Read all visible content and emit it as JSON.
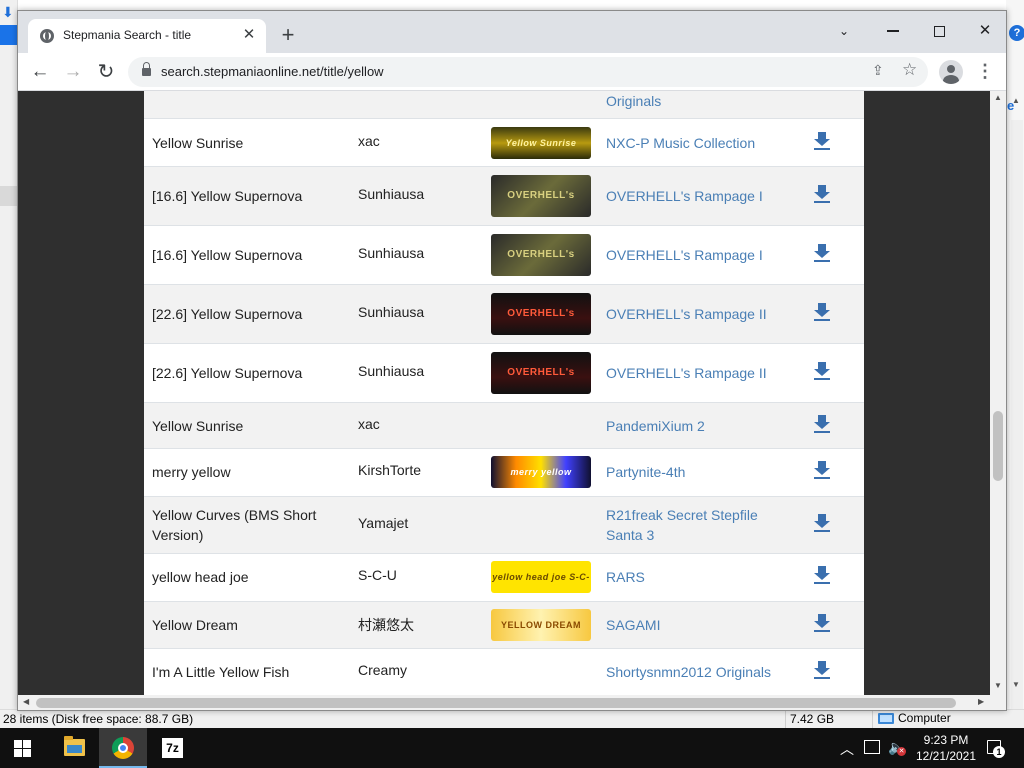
{
  "browser": {
    "tab_title": "Stepmania Search - title",
    "url": "search.stepmaniaonline.net/title/yellow",
    "tab_close": "✕",
    "new_tab": "+"
  },
  "partial_row": {
    "pack": "Originals"
  },
  "rows": [
    {
      "title": "Yellow Sunrise",
      "artist": "xac",
      "banner_text": "Yellow Sunrise",
      "pack": "NXC-P Music Collection"
    },
    {
      "title": "[16.6] Yellow Supernova",
      "artist": "Sunhiausa",
      "banner_text": "OVERHELL's RAMPAGE",
      "pack": "OVERHELL's Rampage I"
    },
    {
      "title": "[16.6] Yellow Supernova",
      "artist": "Sunhiausa",
      "banner_text": "OVERHELL's RAMPAGE",
      "pack": "OVERHELL's Rampage I"
    },
    {
      "title": "[22.6] Yellow Supernova",
      "artist": "Sunhiausa",
      "banner_text": "OVERHELL's RAMPAGE II",
      "pack": "OVERHELL's Rampage II"
    },
    {
      "title": "[22.6] Yellow Supernova",
      "artist": "Sunhiausa",
      "banner_text": "OVERHELL's RAMPAGE II",
      "pack": "OVERHELL's Rampage II"
    },
    {
      "title": "Yellow Sunrise",
      "artist": "xac",
      "banner_text": "",
      "pack": "PandemiXium 2"
    },
    {
      "title": "merry yellow",
      "artist": "KirshTorte",
      "banner_text": "merry yellow KirshTorte",
      "pack": "Partynite-4th"
    },
    {
      "title": "Yellow Curves (BMS Short Version)",
      "artist": "Yamajet",
      "banner_text": "",
      "pack": "R21freak Secret Stepfile Santa 3"
    },
    {
      "title": "yellow head joe",
      "artist": "S-C-U",
      "banner_text": "yellow head joe S-C-U",
      "pack": "RARS"
    },
    {
      "title": "Yellow Dream",
      "artist": "村瀬悠太",
      "banner_text": "YELLOW DREAM",
      "pack": "SAGAMI"
    },
    {
      "title": "I'm A Little Yellow Fish",
      "artist": "Creamy",
      "banner_text": "",
      "pack": "Shortysnmn2012 Originals"
    }
  ],
  "explorer_status": {
    "items": "28 items (Disk free space: 88.7 GB)",
    "size": "7.42 GB",
    "location": "Computer"
  },
  "taskbar": {
    "time": "9:23 PM",
    "date": "12/21/2021",
    "notifications": "1",
    "sevenzip_label": "7z"
  },
  "colors": {
    "link": "#4a7fb5",
    "download_icon": "#3a6fae",
    "page_bg": "#2f2f2f"
  }
}
